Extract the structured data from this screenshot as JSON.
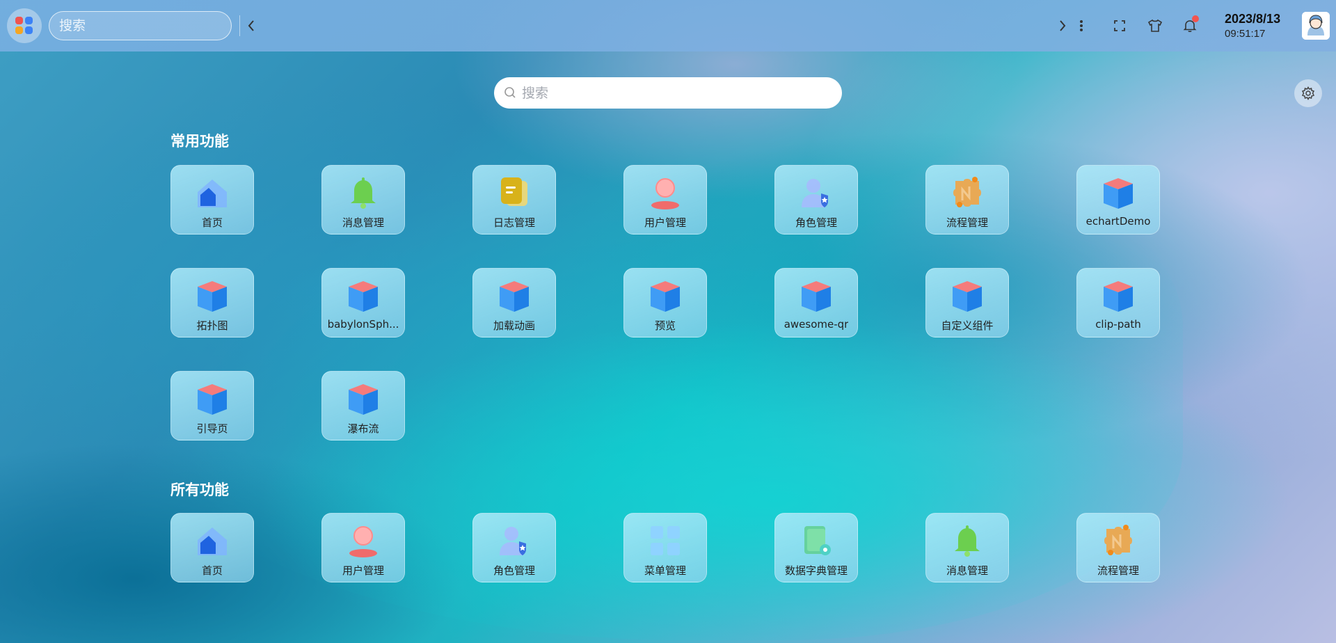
{
  "topbar": {
    "search_placeholder": "搜索",
    "date": "2023/8/13",
    "time": "09:51:17"
  },
  "main": {
    "search_placeholder": "搜索"
  },
  "sections": {
    "common": {
      "title": "常用功能",
      "items": [
        {
          "label": "首页",
          "icon": "home-icon"
        },
        {
          "label": "消息管理",
          "icon": "bell-icon"
        },
        {
          "label": "日志管理",
          "icon": "log-icon"
        },
        {
          "label": "用户管理",
          "icon": "user-icon"
        },
        {
          "label": "角色管理",
          "icon": "role-icon"
        },
        {
          "label": "流程管理",
          "icon": "flow-icon"
        },
        {
          "label": "echartDemo",
          "icon": "cube-icon"
        },
        {
          "label": "拓扑图",
          "icon": "cube-icon"
        },
        {
          "label": "babylonSph...",
          "icon": "cube-icon"
        },
        {
          "label": "加载动画",
          "icon": "cube-icon"
        },
        {
          "label": "预览",
          "icon": "cube-icon"
        },
        {
          "label": "awesome-qr",
          "icon": "cube-icon"
        },
        {
          "label": "自定义组件",
          "icon": "cube-icon"
        },
        {
          "label": "clip-path",
          "icon": "cube-icon"
        },
        {
          "label": "引导页",
          "icon": "cube-icon"
        },
        {
          "label": "瀑布流",
          "icon": "cube-icon"
        }
      ]
    },
    "all": {
      "title": "所有功能",
      "items": [
        {
          "label": "首页",
          "icon": "home-icon"
        },
        {
          "label": "用户管理",
          "icon": "user-icon"
        },
        {
          "label": "角色管理",
          "icon": "role-icon"
        },
        {
          "label": "菜单管理",
          "icon": "menu-grid-icon"
        },
        {
          "label": "数据字典管理",
          "icon": "dictionary-icon"
        },
        {
          "label": "消息管理",
          "icon": "bell-icon"
        },
        {
          "label": "流程管理",
          "icon": "flow-icon"
        }
      ]
    }
  }
}
